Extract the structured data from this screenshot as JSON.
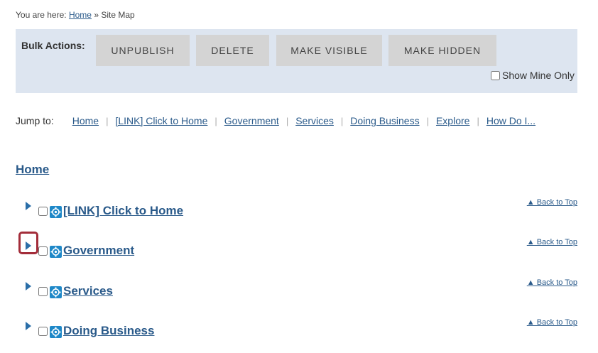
{
  "breadcrumb": {
    "prefix": "You are here:",
    "home_link": "Home",
    "separator": "»",
    "current": "Site Map"
  },
  "bulk_actions": {
    "label": "Bulk Actions:",
    "buttons": [
      "UNPUBLISH",
      "DELETE",
      "MAKE VISIBLE",
      "MAKE HIDDEN"
    ],
    "show_mine_label": "Show Mine Only",
    "show_mine_checked": false
  },
  "jump": {
    "label": "Jump to:",
    "links": [
      "Home",
      "[LINK] Click to Home",
      "Government",
      "Services",
      "Doing Business",
      "Explore",
      "How Do I..."
    ]
  },
  "home_heading": "Home",
  "tree": [
    {
      "label": "[LINK] Click to Home",
      "back_to_top": "▲ Back to Top",
      "highlighted": false
    },
    {
      "label": "Government",
      "back_to_top": "▲ Back to Top",
      "highlighted": true
    },
    {
      "label": "Services",
      "back_to_top": "▲ Back to Top",
      "highlighted": false
    },
    {
      "label": "Doing Business",
      "back_to_top": "▲ Back to Top",
      "highlighted": false
    }
  ],
  "colors": {
    "link": "#2a5a8a",
    "panel_bg": "#dde5f0",
    "button_bg": "#d4d4d4",
    "toggle": "#2a6ea8",
    "highlight": "#a32d3a",
    "icon": "#1e88c8"
  }
}
